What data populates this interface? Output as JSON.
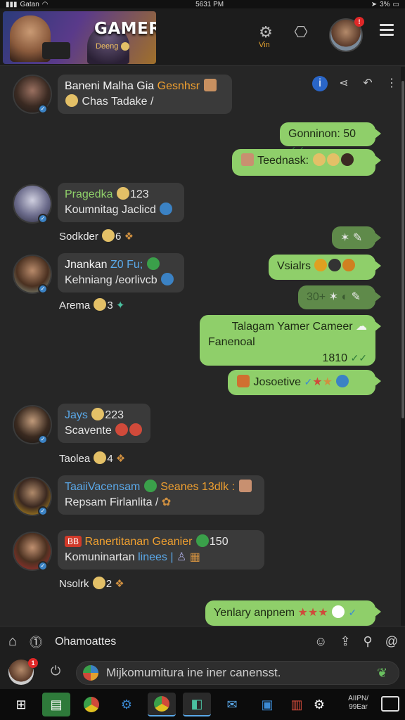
{
  "statusbar": {
    "carrier": "Gatan",
    "time": "5631 PM",
    "battery": "3%"
  },
  "header": {
    "banner_title": "GAMER",
    "banner_sub": "Deeng",
    "settings_sub": "Vin"
  },
  "messages": {
    "m1": {
      "name": "Baneni Malha Gia",
      "name_suffix": "Gesnhsr",
      "line2": "Chas Tadake /"
    },
    "o1": {
      "text": "Gonninon: 50"
    },
    "o2": {
      "text": "Teednask:"
    },
    "m2": {
      "name": "Pragedka",
      "count": "123",
      "line2": "Koumnitag Jaclicd",
      "react": "Sodkder",
      "react_count": "6"
    },
    "m3": {
      "name": "Jnankan",
      "name_suffix": "Z0 Fu;",
      "line2": "Kehniang /eorlivcb",
      "react": "Arema",
      "react_count": "3"
    },
    "o3": {
      "text": "Vsialrs"
    },
    "o4": {
      "text": "30+"
    },
    "o5": {
      "line1": "Talagam Yamer Cameer",
      "line2": "Fanenoal",
      "time": "1810"
    },
    "o6": {
      "text": "Josoetive"
    },
    "m4": {
      "name": "Jays",
      "count": "223",
      "line2": "Scavente",
      "react": "Taolea",
      "react_count": "4"
    },
    "m5": {
      "name": "TaaiiVacensam",
      "name_suffix": "Seanes 13dlk :",
      "line2": "Repsam Firlanlita /"
    },
    "m6": {
      "pill": "BB",
      "name": "Ranertitanan Geanier",
      "count": "150",
      "line2": "Komuninartan",
      "line2_suffix": "linees |",
      "react": "Nsolrk",
      "react_count": "2"
    },
    "o7": {
      "text": "Yenlary anpnem"
    }
  },
  "bottom_nav": {
    "tab_label": "Ohamoattes"
  },
  "composer": {
    "placeholder": "Mijkomumitura ine iner canensst."
  },
  "taskbar": {
    "clock_line1": "AIIPN/",
    "clock_line2": "99Ear"
  }
}
